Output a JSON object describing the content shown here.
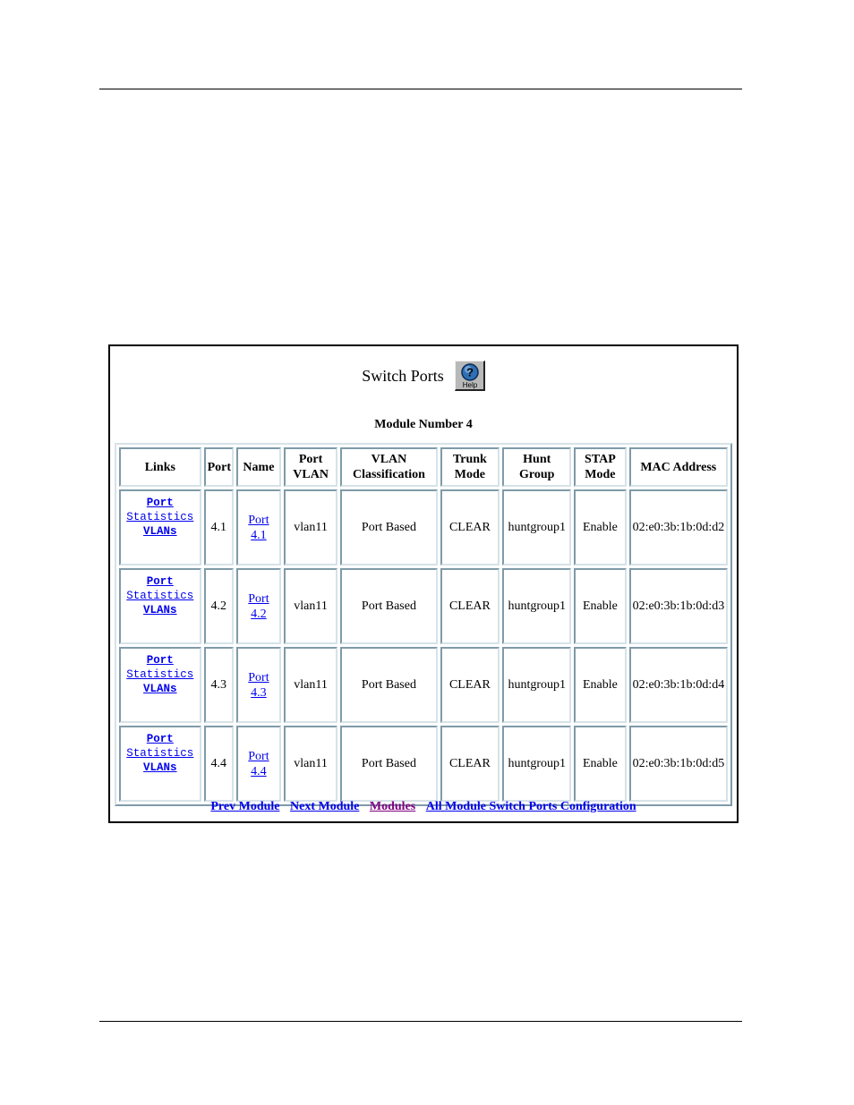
{
  "page": {
    "title": "Switch Ports",
    "help_label": "Help",
    "module_label": "Module Number 4"
  },
  "table": {
    "headers": [
      "Links",
      "Port",
      "Name",
      "Port VLAN",
      "VLAN Classification",
      "Trunk Mode",
      "Hunt Group",
      "STAP Mode",
      "MAC Address"
    ],
    "header_lines": {
      "port_vlan": [
        "Port",
        "VLAN"
      ],
      "vlan_classification": [
        "VLAN",
        "Classification"
      ],
      "trunk_mode": [
        "Trunk",
        "Mode"
      ],
      "hunt_group": [
        "Hunt",
        "Group"
      ],
      "stap_mode": [
        "STAP",
        "Mode"
      ]
    },
    "rows": [
      {
        "links": [
          "Port",
          "Statistics",
          "VLANs"
        ],
        "port": "4.1",
        "name_lines": [
          "Port",
          "4.1"
        ],
        "port_vlan": "vlan11",
        "vlan_classification": "Port Based",
        "trunk_mode": "CLEAR",
        "hunt_group": "huntgroup1",
        "stap_mode": "Enable",
        "mac_address": "02:e0:3b:1b:0d:d2"
      },
      {
        "links": [
          "Port",
          "Statistics",
          "VLANs"
        ],
        "port": "4.2",
        "name_lines": [
          "Port",
          "4.2"
        ],
        "port_vlan": "vlan11",
        "vlan_classification": "Port Based",
        "trunk_mode": "CLEAR",
        "hunt_group": "huntgroup1",
        "stap_mode": "Enable",
        "mac_address": "02:e0:3b:1b:0d:d3"
      },
      {
        "links": [
          "Port",
          "Statistics",
          "VLANs"
        ],
        "port": "4.3",
        "name_lines": [
          "Port",
          "4.3"
        ],
        "port_vlan": "vlan11",
        "vlan_classification": "Port Based",
        "trunk_mode": "CLEAR",
        "hunt_group": "huntgroup1",
        "stap_mode": "Enable",
        "mac_address": "02:e0:3b:1b:0d:d4"
      },
      {
        "links": [
          "Port",
          "Statistics",
          "VLANs"
        ],
        "port": "4.4",
        "name_lines": [
          "Port",
          "4.4"
        ],
        "port_vlan": "vlan11",
        "vlan_classification": "Port Based",
        "trunk_mode": "CLEAR",
        "hunt_group": "huntgroup1",
        "stap_mode": "Enable",
        "mac_address": "02:e0:3b:1b:0d:d5"
      }
    ]
  },
  "nav": {
    "prev_module": "Prev Module",
    "next_module": "Next Module",
    "modules": "Modules",
    "all_config": "All Module Switch Ports Configuration"
  },
  "colors": {
    "link": "#0000ee",
    "visited_link": "#800080",
    "cell_border_dark": "#7f9aa8",
    "cell_border_light": "#d7e2e8"
  },
  "icons": {
    "help": "help-question-icon"
  }
}
